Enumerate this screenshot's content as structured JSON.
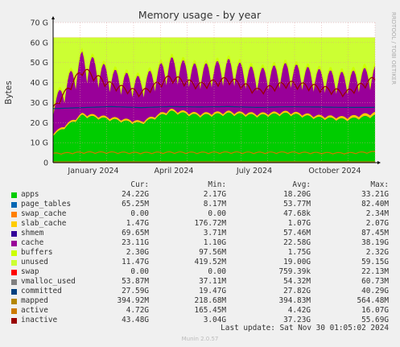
{
  "chart_data": {
    "type": "area",
    "title": "Memory usage - by year",
    "ylabel": "Bytes",
    "side_label": "RRDTOOL / TOBI OETIKER",
    "ylim": [
      0,
      70
    ],
    "y_ticks": [
      "0",
      "10 G",
      "20 G",
      "30 G",
      "40 G",
      "50 G",
      "60 G",
      "70 G"
    ],
    "x_labels": [
      "January 2024",
      "April 2024",
      "July 2024",
      "October 2024"
    ],
    "x_months": [
      "2023-12",
      "2024-01",
      "2024-02",
      "2024-03",
      "2024-04",
      "2024-05",
      "2024-06",
      "2024-07",
      "2024-08",
      "2024-09",
      "2024-10",
      "2024-11"
    ],
    "series": [
      {
        "name": "apps",
        "color": "#00cc00",
        "values": [
          14,
          24,
          22,
          20,
          26,
          24,
          25,
          24,
          25,
          23,
          22,
          24
        ],
        "mode": "stack"
      },
      {
        "name": "page_tables",
        "color": "#0066b3",
        "values": [
          0.05,
          0.05,
          0.05,
          0.05,
          0.05,
          0.05,
          0.05,
          0.05,
          0.05,
          0.05,
          0.05,
          0.06
        ],
        "mode": "stack"
      },
      {
        "name": "swap_cache",
        "color": "#ff8000",
        "values": [
          0,
          0,
          0,
          0,
          0,
          0,
          0,
          0,
          0,
          0,
          0,
          0
        ],
        "mode": "stack"
      },
      {
        "name": "slab_cache",
        "color": "#ffcc00",
        "values": [
          1,
          1,
          1,
          1,
          1,
          1,
          1,
          1,
          1,
          1,
          1.2,
          1.5
        ],
        "mode": "stack"
      },
      {
        "name": "shmem",
        "color": "#330099",
        "values": [
          0.06,
          0.06,
          0.06,
          0.06,
          0.06,
          0.06,
          0.06,
          0.06,
          0.06,
          0.06,
          0.06,
          0.07
        ],
        "mode": "stack"
      },
      {
        "name": "cache",
        "color": "#990099",
        "values": [
          16,
          31,
          24,
          22,
          26,
          24,
          26,
          22,
          24,
          23,
          22,
          23
        ],
        "mode": "stack"
      },
      {
        "name": "buffers",
        "color": "#ccff00",
        "values": [
          1.5,
          1.8,
          1.7,
          1.7,
          1.8,
          1.7,
          1.8,
          1.7,
          1.8,
          1.7,
          1.8,
          2.3
        ],
        "mode": "stack"
      },
      {
        "name": "unused",
        "color": "#ccff33",
        "values": [
          30,
          4,
          13,
          17,
          6,
          11,
          8,
          13,
          10,
          13,
          16,
          11.5
        ],
        "mode": "stack"
      },
      {
        "name": "swap",
        "color": "#ff0000",
        "values": [
          0,
          0,
          0,
          0,
          0,
          0,
          0,
          0,
          0,
          0,
          0,
          0
        ],
        "mode": "stack"
      },
      {
        "name": "vmalloc_used",
        "color": "#808080",
        "values": [
          0.05,
          0.05,
          0.05,
          0.05,
          0.05,
          0.05,
          0.05,
          0.05,
          0.05,
          0.05,
          0.05,
          0.05
        ],
        "mode": "line"
      },
      {
        "name": "committed",
        "color": "#004080",
        "values": [
          27,
          27.5,
          28,
          27.5,
          28,
          27.8,
          28,
          27.6,
          27.9,
          27.8,
          27.6,
          27.6
        ],
        "mode": "line"
      },
      {
        "name": "mapped",
        "color": "#b38600",
        "values": [
          0.4,
          0.4,
          0.4,
          0.4,
          0.4,
          0.4,
          0.4,
          0.4,
          0.4,
          0.4,
          0.4,
          0.39
        ],
        "mode": "line"
      },
      {
        "name": "active",
        "color": "#cc7a00",
        "values": [
          4,
          4.5,
          4.5,
          4.3,
          4.5,
          4.4,
          4.5,
          4.4,
          4.5,
          4.3,
          4.2,
          4.7
        ],
        "mode": "line"
      },
      {
        "name": "inactive",
        "color": "#990000",
        "values": [
          28,
          48,
          40,
          36,
          44,
          40,
          43,
          37,
          41,
          39,
          36,
          43.5
        ],
        "mode": "line"
      }
    ],
    "legend_headers": [
      "Cur:",
      "Min:",
      "Avg:",
      "Max:"
    ],
    "legend": [
      {
        "name": "apps",
        "color": "#00cc00",
        "cur": "24.22G",
        "min": "2.17G",
        "avg": "18.20G",
        "max": "33.21G"
      },
      {
        "name": "page_tables",
        "color": "#0066b3",
        "cur": "65.25M",
        "min": "8.17M",
        "avg": "53.77M",
        "max": "82.40M"
      },
      {
        "name": "swap_cache",
        "color": "#ff8000",
        "cur": "0.00",
        "min": "0.00",
        "avg": "47.68k",
        "max": "2.34M"
      },
      {
        "name": "slab_cache",
        "color": "#ffcc00",
        "cur": "1.47G",
        "min": "176.72M",
        "avg": "1.07G",
        "max": "2.07G"
      },
      {
        "name": "shmem",
        "color": "#330099",
        "cur": "69.65M",
        "min": "3.71M",
        "avg": "57.46M",
        "max": "87.45M"
      },
      {
        "name": "cache",
        "color": "#990099",
        "cur": "23.11G",
        "min": "1.10G",
        "avg": "22.58G",
        "max": "38.19G"
      },
      {
        "name": "buffers",
        "color": "#ccff00",
        "cur": "2.30G",
        "min": "97.56M",
        "avg": "1.75G",
        "max": "2.32G"
      },
      {
        "name": "unused",
        "color": "#ccff33",
        "cur": "11.47G",
        "min": "419.52M",
        "avg": "19.00G",
        "max": "59.15G"
      },
      {
        "name": "swap",
        "color": "#ff0000",
        "cur": "0.00",
        "min": "0.00",
        "avg": "759.39k",
        "max": "22.13M"
      },
      {
        "name": "vmalloc_used",
        "color": "#808080",
        "cur": "53.87M",
        "min": "37.11M",
        "avg": "54.32M",
        "max": "60.73M"
      },
      {
        "name": "committed",
        "color": "#004080",
        "cur": "27.59G",
        "min": "19.47G",
        "avg": "27.82G",
        "max": "40.29G"
      },
      {
        "name": "mapped",
        "color": "#b38600",
        "cur": "394.92M",
        "min": "218.68M",
        "avg": "394.83M",
        "max": "564.48M"
      },
      {
        "name": "active",
        "color": "#cc7a00",
        "cur": "4.72G",
        "min": "165.45M",
        "avg": "4.42G",
        "max": "16.07G"
      },
      {
        "name": "inactive",
        "color": "#990000",
        "cur": "43.48G",
        "min": "3.04G",
        "avg": "37.23G",
        "max": "55.69G"
      }
    ],
    "last_update": "Last update: Sat Nov 30 01:05:02 2024",
    "footer": "Munin 2.0.57",
    "grid": true,
    "legend_position": "bottom"
  }
}
